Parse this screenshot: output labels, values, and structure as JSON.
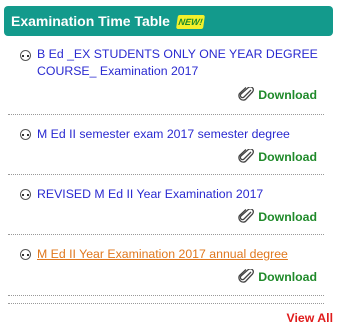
{
  "header": {
    "title": "Examination Time Table",
    "badge": "NEW!"
  },
  "items": [
    {
      "title": "B Ed _EX STUDENTS ONLY ONE YEAR DEGREE COURSE_ Examination 2017",
      "download": "Download"
    },
    {
      "title": "M Ed II semester exam 2017 semester degree",
      "download": "Download"
    },
    {
      "title": "REVISED M Ed II Year Examination 2017",
      "download": "Download"
    },
    {
      "title": "M Ed II Year Examination 2017 annual degree",
      "download": "Download"
    }
  ],
  "footer": {
    "view_all": "View All"
  },
  "colors": {
    "header_bg": "#139a8c",
    "link": "#2a2ad0",
    "visited_link": "#e0781e",
    "download": "#1f8a2a",
    "view_all": "#e01c1c"
  }
}
